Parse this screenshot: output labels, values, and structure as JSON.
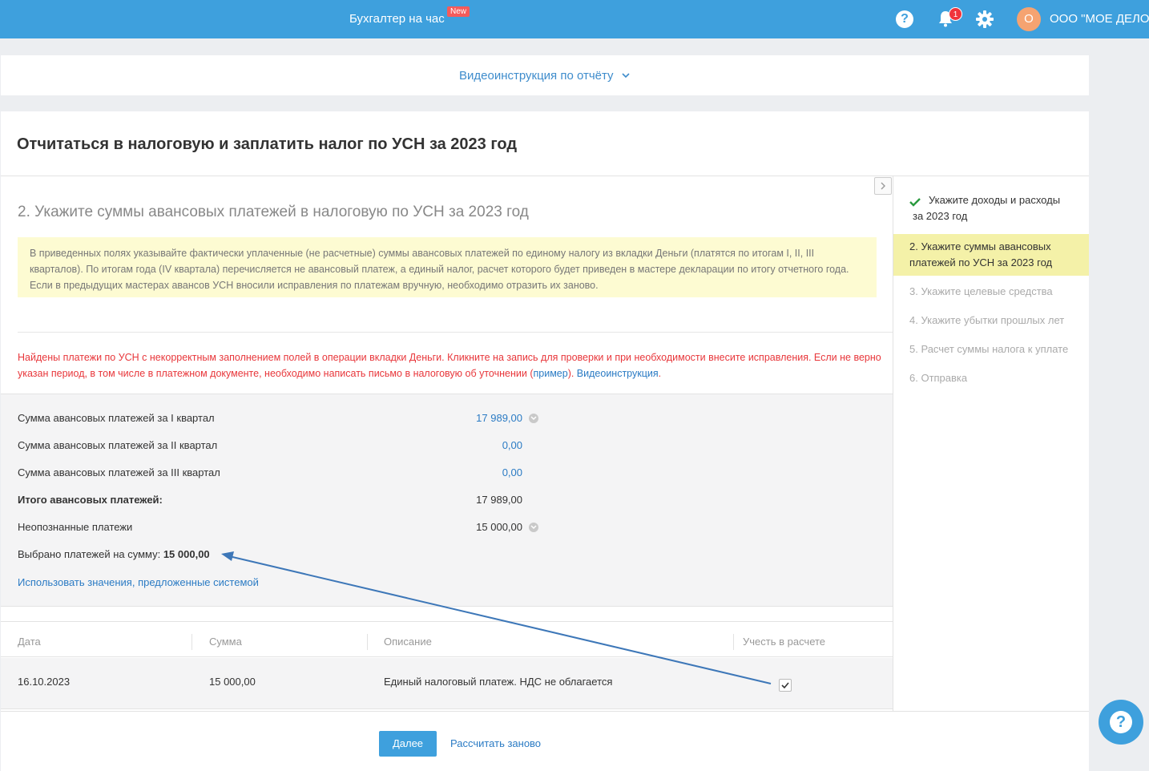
{
  "topbar": {
    "service_label": "Бухгалтер на час",
    "new_badge": "New",
    "notifications_count": "1",
    "avatar_letter": "О",
    "org_name": "ООО \"МОЕ ДЕЛО\"",
    "help_glyph": "?"
  },
  "video": {
    "label": "Видеоинструкция по отчёту"
  },
  "page": {
    "title": "Отчитаться в налоговую и заплатить налог по УСН за 2023 год",
    "step_title": "2. Укажите суммы авансовых платежей в налоговую по УСН за 2023 год",
    "note_text": "В приведенных полях указывайте фактически уплаченные (не расчетные) суммы авансовых платежей по единому налогу из вкладки Деньги (платятся по итогам I, II, III кварталов). По итогам года (IV квартала) перечисляется не авансовый платеж, а единый налог, расчет которого будет приведен в мастере декларации по итогу отчетного года. Если в предыдущих мастерах авансов УСН вносили исправления по платежам вручную, необходимо отразить их заново.",
    "warning_text": "Найдены платежи по УСН с некорректным заполнением полей в операции вкладки Деньги. Кликните на запись для проверки и при необходимости внесите исправления. Если не верно указан период, в том числе в платежном документе, необходимо написать письмо в налоговую об уточнении (",
    "warning_link_example": "пример",
    "warning_mid": "). ",
    "warning_link_video": "Видеоинструкция",
    "warning_end": "."
  },
  "sums": {
    "q1_label": "Сумма авансовых платежей за I квартал",
    "q1_value": "17 989,00",
    "q2_label": "Сумма авансовых платежей за II квартал",
    "q2_value": "0,00",
    "q3_label": "Сумма авансовых платежей за III квартал",
    "q3_value": "0,00",
    "total_label": "Итого авансовых платежей:",
    "total_value": "17 989,00",
    "unknown_label": "Неопознанные платежи",
    "unknown_value": "15 000,00",
    "selected_label": "Выбрано платежей на сумму: ",
    "selected_value": "15 000,00",
    "use_system_link": "Использовать значения, предложенные системой"
  },
  "table": {
    "columns": [
      "Дата",
      "Сумма",
      "Описание",
      "Учесть в расчете"
    ],
    "rows": [
      {
        "date": "16.10.2023",
        "amount": "15 000,00",
        "description": "Единый налоговый платеж. НДС не облагается",
        "checked": true
      }
    ]
  },
  "actions": {
    "next_label": "Далее",
    "recalc_label": "Рассчитать заново"
  },
  "steps": [
    {
      "label": "Укажите доходы и расходы за 2023 год",
      "state": "done"
    },
    {
      "label": "2.  Укажите суммы авансовых платежей по УСН за 2023 год",
      "state": "active"
    },
    {
      "label": "3.  Укажите целевые средства",
      "state": "future"
    },
    {
      "label": "4.  Укажите убытки прошлых лет",
      "state": "future"
    },
    {
      "label": "5.  Расчет суммы налога к уплате",
      "state": "future"
    },
    {
      "label": "6.  Отправка",
      "state": "future"
    }
  ],
  "colors": {
    "brand": "#3ea0dd",
    "link": "#2b7bc4",
    "warning": "#e8373b",
    "note_bg": "#fdfbd2",
    "active_step_bg": "#f4f1a8",
    "check_green": "#2a9a3f",
    "annotation_arrow": "#3d77b8"
  },
  "icons": {
    "help": "help-circle-icon",
    "bell": "bell-icon",
    "gear": "gear-icon",
    "chevron": "chevron-down-icon",
    "collapse": "chevron-right-icon",
    "check": "check-icon"
  }
}
